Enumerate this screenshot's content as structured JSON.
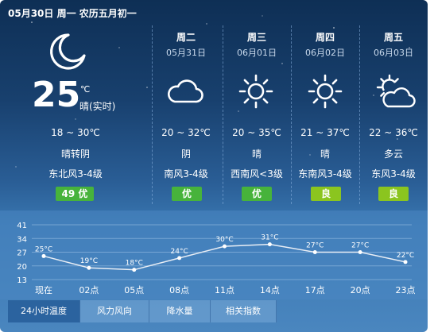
{
  "header": {
    "date_line": "05月30日 周一 农历五月初一"
  },
  "today": {
    "icon": "moon-icon",
    "temperature": "25",
    "unit": "℃",
    "condition": "晴(实时)",
    "range": "18 ~ 30℃",
    "weather": "晴转阴",
    "wind": "东北风3-4级",
    "aqi": "49 优"
  },
  "forecast": [
    {
      "day": "周二",
      "date": "05月31日",
      "icon": "cloud-icon",
      "range": "20 ~ 32℃",
      "weather": "阴",
      "wind": "南风3-4级",
      "aqi": "优",
      "aqi_level": "good"
    },
    {
      "day": "周三",
      "date": "06月01日",
      "icon": "sun-icon",
      "range": "20 ~ 35℃",
      "weather": "晴",
      "wind": "西南风<3级",
      "aqi": "优",
      "aqi_level": "good"
    },
    {
      "day": "周四",
      "date": "06月02日",
      "icon": "sun-icon",
      "range": "21 ~ 37℃",
      "weather": "晴",
      "wind": "东南风3-4级",
      "aqi": "良",
      "aqi_level": "moderate"
    },
    {
      "day": "周五",
      "date": "06月03日",
      "icon": "partly-cloudy-icon",
      "range": "22 ~ 36℃",
      "weather": "多云",
      "wind": "东风3-4级",
      "aqi": "良",
      "aqi_level": "moderate"
    }
  ],
  "colors": {
    "good": "#47b33b",
    "moderate": "#8bc51f"
  },
  "chart_data": {
    "type": "line",
    "yticks": [
      "41",
      "34",
      "27",
      "20",
      "13"
    ],
    "ylim": [
      13,
      41
    ],
    "x": [
      "现在",
      "02点",
      "05点",
      "08点",
      "11点",
      "14点",
      "17点",
      "20点",
      "23点"
    ],
    "values": [
      25,
      19,
      18,
      24,
      30,
      31,
      27,
      27,
      22
    ],
    "labels": [
      "25°C",
      "19°C",
      "18°C",
      "24°C",
      "30°C",
      "31°C",
      "27°C",
      "27°C",
      "22°C"
    ]
  },
  "tabs": [
    {
      "label": "24小时温度",
      "active": true
    },
    {
      "label": "风力风向",
      "active": false
    },
    {
      "label": "降水量",
      "active": false
    },
    {
      "label": "相关指数",
      "active": false
    }
  ]
}
